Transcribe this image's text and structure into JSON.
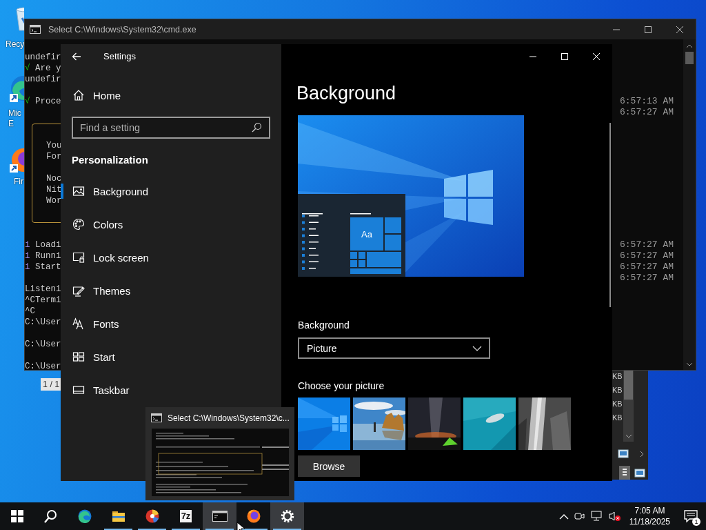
{
  "desktop": {
    "icons": [
      {
        "kind": "recycle",
        "label_lines": [
          "Recy"
        ]
      },
      {
        "kind": "edge",
        "label_lines": [
          "Mic",
          "E"
        ]
      },
      {
        "kind": "firefox",
        "label_lines": [
          "Fir"
        ]
      }
    ]
  },
  "background_window": {
    "page_indicator": "1 / 1",
    "size_cells": [
      "KB",
      "KB",
      "KB",
      "KB"
    ]
  },
  "cmd_window": {
    "title": "Select C:\\Windows\\System32\\cmd.exe",
    "lines": [
      {
        "kind": "text",
        "text": "undefir"
      },
      {
        "kind": "check",
        "mark": "√",
        "text": "Are y"
      },
      {
        "kind": "text",
        "text": "undefir"
      },
      {
        "kind": "blank"
      },
      {
        "kind": "check",
        "mark": "√",
        "text": "Proce",
        "time": "6:57:13 AM"
      },
      {
        "kind": "blank",
        "time": "6:57:27 AM"
      },
      {
        "kind": "box",
        "lines": [
          {
            "kind": "blank"
          },
          {
            "kind": "text",
            "text": "You"
          },
          {
            "kind": "text",
            "text": "For"
          },
          {
            "kind": "blank"
          },
          {
            "kind": "text",
            "text": "Noc"
          },
          {
            "kind": "text",
            "text": "Nit"
          },
          {
            "kind": "text",
            "text": "Wor"
          },
          {
            "kind": "blank"
          }
        ]
      },
      {
        "kind": "blank"
      },
      {
        "kind": "info",
        "mark": "i",
        "text": "Loadi",
        "time": "6:57:27 AM"
      },
      {
        "kind": "info",
        "mark": "i",
        "text": "Runni",
        "time": "6:57:27 AM"
      },
      {
        "kind": "info",
        "mark": "i",
        "text": "Start",
        "time": "6:57:27 AM"
      },
      {
        "kind": "blank",
        "time": "6:57:27 AM"
      },
      {
        "kind": "text",
        "text": "Listeni"
      },
      {
        "kind": "text",
        "text": "^CTermi"
      },
      {
        "kind": "text",
        "text": "^C"
      },
      {
        "kind": "text",
        "text": "C:\\User"
      },
      {
        "kind": "blank"
      },
      {
        "kind": "text",
        "text": "C:\\User"
      },
      {
        "kind": "blank"
      },
      {
        "kind": "text",
        "text": "C:\\User"
      }
    ]
  },
  "settings": {
    "title": "Settings",
    "home": "Home",
    "search": {
      "placeholder": "Find a setting"
    },
    "section": "Personalization",
    "items": [
      {
        "kind": "picture",
        "label": "Background",
        "selected": true
      },
      {
        "kind": "palette",
        "label": "Colors",
        "selected": false
      },
      {
        "kind": "lock",
        "label": "Lock screen",
        "selected": false
      },
      {
        "kind": "brush",
        "label": "Themes",
        "selected": false
      },
      {
        "kind": "fonts",
        "label": "Fonts",
        "selected": false
      },
      {
        "kind": "tiles",
        "label": "Start",
        "selected": false
      },
      {
        "kind": "taskbar",
        "label": "Taskbar",
        "selected": false
      }
    ],
    "page": {
      "heading": "Background",
      "preview_tile": "Aa",
      "background_label": "Background",
      "background_value": "Picture",
      "choose_label": "Choose your picture",
      "browse": "Browse"
    }
  },
  "thumbnail_popup": {
    "title": "Select C:\\Windows\\System32\\c..."
  },
  "taskbar": {
    "items": [
      {
        "kind": "start",
        "running": false,
        "highlighted": false
      },
      {
        "kind": "search",
        "running": false,
        "highlighted": false
      },
      {
        "kind": "edge",
        "running": false,
        "highlighted": false
      },
      {
        "kind": "folder",
        "running": true,
        "highlighted": false
      },
      {
        "kind": "ball",
        "running": true,
        "highlighted": false
      },
      {
        "kind": "text",
        "label": "7z",
        "running": true,
        "highlighted": false
      },
      {
        "kind": "terminal",
        "running": true,
        "highlighted": true
      },
      {
        "kind": "firefox",
        "running": true,
        "highlighted": false
      },
      {
        "kind": "gear",
        "running": true,
        "highlighted": true
      }
    ],
    "clock": {
      "time": "7:05 AM",
      "date": "11/18/2025"
    },
    "notification_count": "1"
  }
}
